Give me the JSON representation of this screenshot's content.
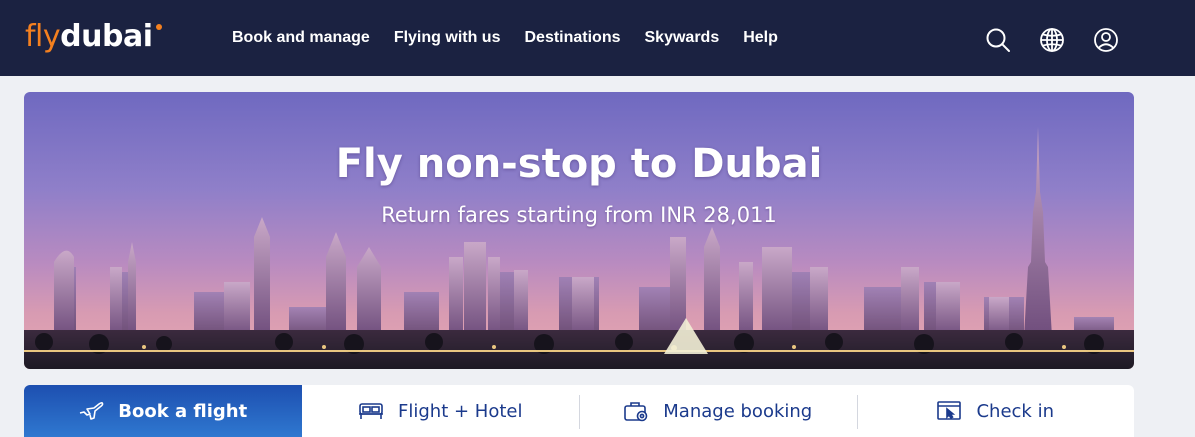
{
  "brand": {
    "logo_fly": "fly",
    "logo_dubai": "dubai",
    "accent_color": "#f4801f",
    "header_bg": "#1b2241"
  },
  "nav": {
    "items": [
      {
        "label": "Book and manage"
      },
      {
        "label": "Flying with us"
      },
      {
        "label": "Destinations"
      },
      {
        "label": "Skywards"
      },
      {
        "label": "Help"
      }
    ],
    "icons": [
      "search-icon",
      "globe-icon",
      "user-account-icon"
    ]
  },
  "hero": {
    "title": "Fly non-stop to Dubai",
    "subtitle": "Return fares starting from INR 28,011"
  },
  "tabs": [
    {
      "label": "Book a flight",
      "icon": "airplane-icon",
      "active": true
    },
    {
      "label": "Flight + Hotel",
      "icon": "bed-icon",
      "active": false
    },
    {
      "label": "Manage booking",
      "icon": "briefcase-gear-icon",
      "active": false
    },
    {
      "label": "Check in",
      "icon": "web-checkin-icon",
      "active": false
    }
  ],
  "colors": {
    "tab_active": "#2a6cc4",
    "tab_text": "#1b3a8c"
  }
}
